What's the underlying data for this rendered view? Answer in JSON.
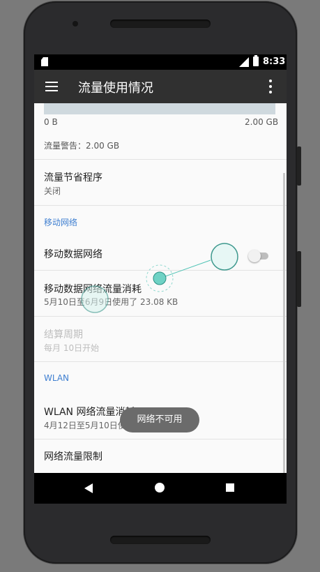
{
  "status_bar": {
    "time": "8:33"
  },
  "toolbar": {
    "title": "流量使用情况"
  },
  "usage_chart": {
    "min_label": "0 B",
    "max_label": "2.00 GB"
  },
  "warning": {
    "text": "流量警告：2.00 GB"
  },
  "data_saver": {
    "title": "流量节省程序",
    "status": "关闭"
  },
  "mobile_section": {
    "header": "移动网络",
    "mobile_data": {
      "title": "移动数据网络",
      "enabled": false
    },
    "mobile_usage": {
      "title": "移动数据网络流量消耗",
      "subtitle": "5月10日至6月9日使用了 23.08 KB"
    },
    "billing_cycle": {
      "title": "结算周期",
      "subtitle": "每月 10日开始"
    }
  },
  "wlan_section": {
    "header": "WLAN",
    "wlan_usage": {
      "title": "WLAN 网络流量消耗",
      "subtitle": "4月12日至5月10日使"
    },
    "network_restrictions": {
      "title": "网络流量限制"
    }
  },
  "toast": {
    "text": "网络不可用"
  },
  "colors": {
    "accent": "#3f7fd0",
    "toolbar": "#303030",
    "touch_indicator": "#4fc3b5"
  }
}
